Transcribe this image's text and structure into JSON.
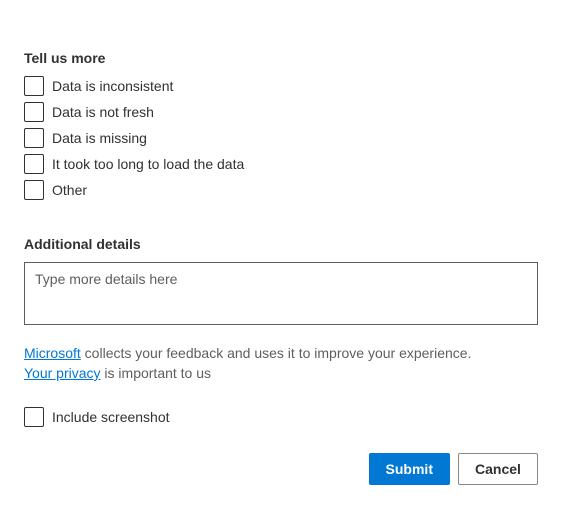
{
  "tellUsMore": {
    "label": "Tell us more",
    "options": [
      {
        "label": "Data is inconsistent"
      },
      {
        "label": "Data is not fresh"
      },
      {
        "label": "Data is missing"
      },
      {
        "label": "It took too long to load the data"
      },
      {
        "label": "Other"
      }
    ]
  },
  "additionalDetails": {
    "label": "Additional details",
    "placeholder": "Type more details here"
  },
  "privacy": {
    "microsoftLink": "Microsoft",
    "collectsText": " collects your feedback and uses it to improve your experience. ",
    "privacyLink": "Your privacy",
    "privacyText": " is important to us"
  },
  "screenshot": {
    "label": "Include screenshot"
  },
  "footer": {
    "submit": "Submit",
    "cancel": "Cancel"
  }
}
